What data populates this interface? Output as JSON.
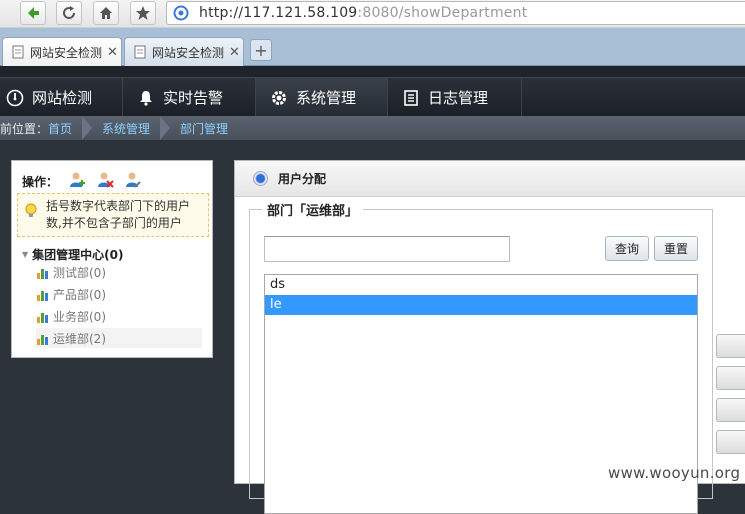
{
  "browser": {
    "url_host": "http://117.121.58.109",
    "url_rest": ":8080/showDepartment",
    "tabs": [
      {
        "label": "网站安全检测",
        "close": "✕"
      },
      {
        "label": "网站安全检测",
        "close": "✕"
      }
    ],
    "new_tab": "+"
  },
  "nav": {
    "items": [
      {
        "label": "网站检测",
        "icon": "gauge-icon"
      },
      {
        "label": "实时告警",
        "icon": "bell-icon"
      },
      {
        "label": "系统管理",
        "icon": "gear-icon"
      },
      {
        "label": "日志管理",
        "icon": "document-icon"
      }
    ],
    "active": "系统管理"
  },
  "breadcrumb": {
    "prefix": "前位置：",
    "items": [
      "首页",
      "系统管理",
      "部门管理"
    ]
  },
  "left": {
    "ops_label": "操作：",
    "tip": "括号数字代表部门下的用户数,并不包含子部门的用户",
    "root": "集团管理中心(0)",
    "departments": [
      "测试部(0)",
      "产品部(0)",
      "业务部(0)",
      "运维部(2)"
    ],
    "selected_index": 3
  },
  "right": {
    "title": "用户分配",
    "fieldset_title": "部门「运维部」",
    "search_value": "",
    "query_button": "查询",
    "reset_button": "重置",
    "users": [
      "ds",
      "le"
    ],
    "selected_user": 1
  },
  "watermark": "www.wooyun.org"
}
